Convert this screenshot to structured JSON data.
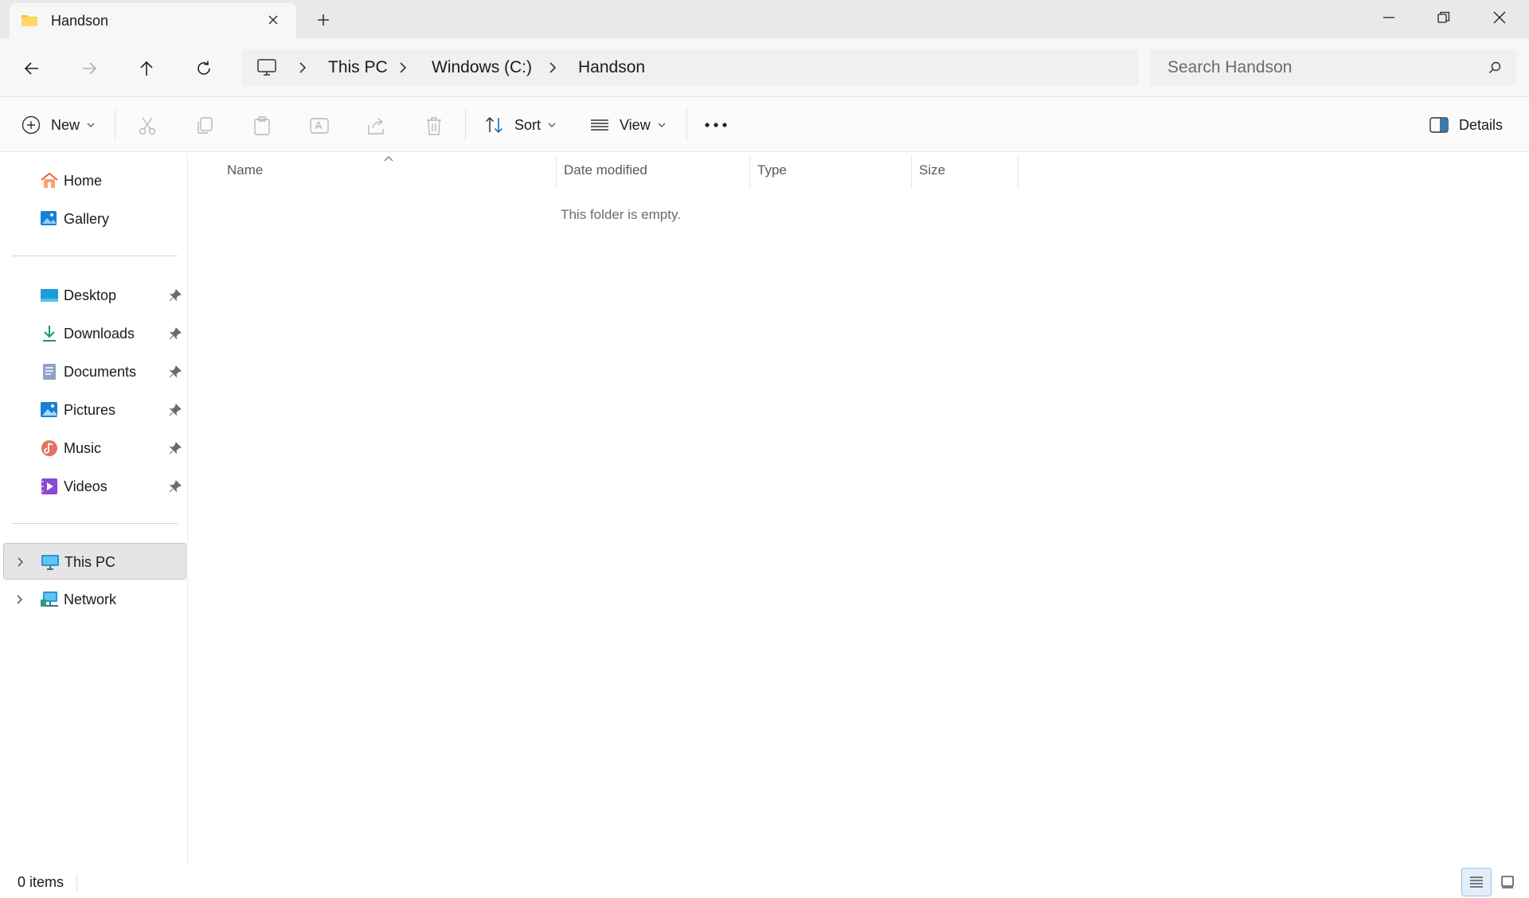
{
  "tab": {
    "title": "Handson"
  },
  "address": {
    "breadcrumbs": [
      "This PC",
      "Windows (C:)",
      "Handson"
    ],
    "search_placeholder": "Search Handson"
  },
  "commands": {
    "new_label": "New",
    "sort_label": "Sort",
    "view_label": "View",
    "details_label": "Details"
  },
  "sidebar": {
    "top": [
      {
        "label": "Home",
        "icon": "home-icon"
      },
      {
        "label": "Gallery",
        "icon": "gallery-icon"
      }
    ],
    "pinned": [
      {
        "label": "Desktop",
        "icon": "desktop-icon"
      },
      {
        "label": "Downloads",
        "icon": "downloads-icon"
      },
      {
        "label": "Documents",
        "icon": "documents-icon"
      },
      {
        "label": "Pictures",
        "icon": "pictures-icon"
      },
      {
        "label": "Music",
        "icon": "music-icon"
      },
      {
        "label": "Videos",
        "icon": "videos-icon"
      }
    ],
    "drives": [
      {
        "label": "This PC",
        "icon": "this-pc-icon",
        "selected": true
      },
      {
        "label": "Network",
        "icon": "network-icon",
        "selected": false
      }
    ]
  },
  "content": {
    "columns": [
      "Name",
      "Date modified",
      "Type",
      "Size"
    ],
    "empty_message": "This folder is empty."
  },
  "status": {
    "items_text": "0 items"
  },
  "colors": {
    "accent": "#0067c0",
    "folder": "#f6c343",
    "selection": "#e5e5e5"
  }
}
